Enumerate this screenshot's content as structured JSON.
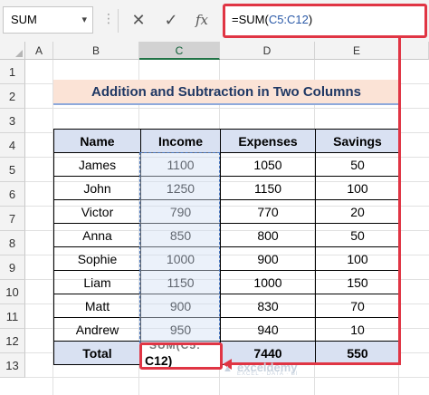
{
  "formula_bar": {
    "name_box": "SUM",
    "formula_prefix": "=SUM(",
    "formula_ref": "C5:C12",
    "formula_suffix": ")",
    "fx_label": "fx"
  },
  "icons": {
    "name_box_dropdown": "chevron-down-icon",
    "cancel": "close-icon",
    "enter": "check-icon",
    "function": "fx-icon"
  },
  "columns": [
    "A",
    "B",
    "C",
    "D",
    "E"
  ],
  "selected_column": "C",
  "rows": [
    "1",
    "2",
    "3",
    "4",
    "5",
    "6",
    "7",
    "8",
    "9",
    "10",
    "11",
    "12",
    "13"
  ],
  "title": "Addition and Subtraction in Two Columns",
  "table": {
    "headers": [
      "Name",
      "Income",
      "Expenses",
      "Savings"
    ],
    "records": [
      {
        "name": "James",
        "income": "1100",
        "expenses": "1050",
        "savings": "50"
      },
      {
        "name": "John",
        "income": "1250",
        "expenses": "1150",
        "savings": "100"
      },
      {
        "name": "Victor",
        "income": "790",
        "expenses": "770",
        "savings": "20"
      },
      {
        "name": "Anna",
        "income": "850",
        "expenses": "800",
        "savings": "50"
      },
      {
        "name": "Sophie",
        "income": "1000",
        "expenses": "900",
        "savings": "100"
      },
      {
        "name": "Liam",
        "income": "1150",
        "expenses": "1000",
        "savings": "150"
      },
      {
        "name": "Matt",
        "income": "900",
        "expenses": "830",
        "savings": "70"
      },
      {
        "name": "Andrew",
        "income": "950",
        "expenses": "940",
        "savings": "10"
      }
    ],
    "total": {
      "label": "Total",
      "expenses": "7440",
      "savings": "550"
    }
  },
  "editing_cell": {
    "ghost_text": "SUM(C5:",
    "text": "C12)"
  },
  "watermark": {
    "text": "exceldemy",
    "sub": "EXCEL · DATA · BI"
  },
  "colors": {
    "accent_red": "#e03544",
    "header_fill": "#d9e1f2",
    "title_fill": "#fbe3d6",
    "excel_green": "#217346"
  }
}
